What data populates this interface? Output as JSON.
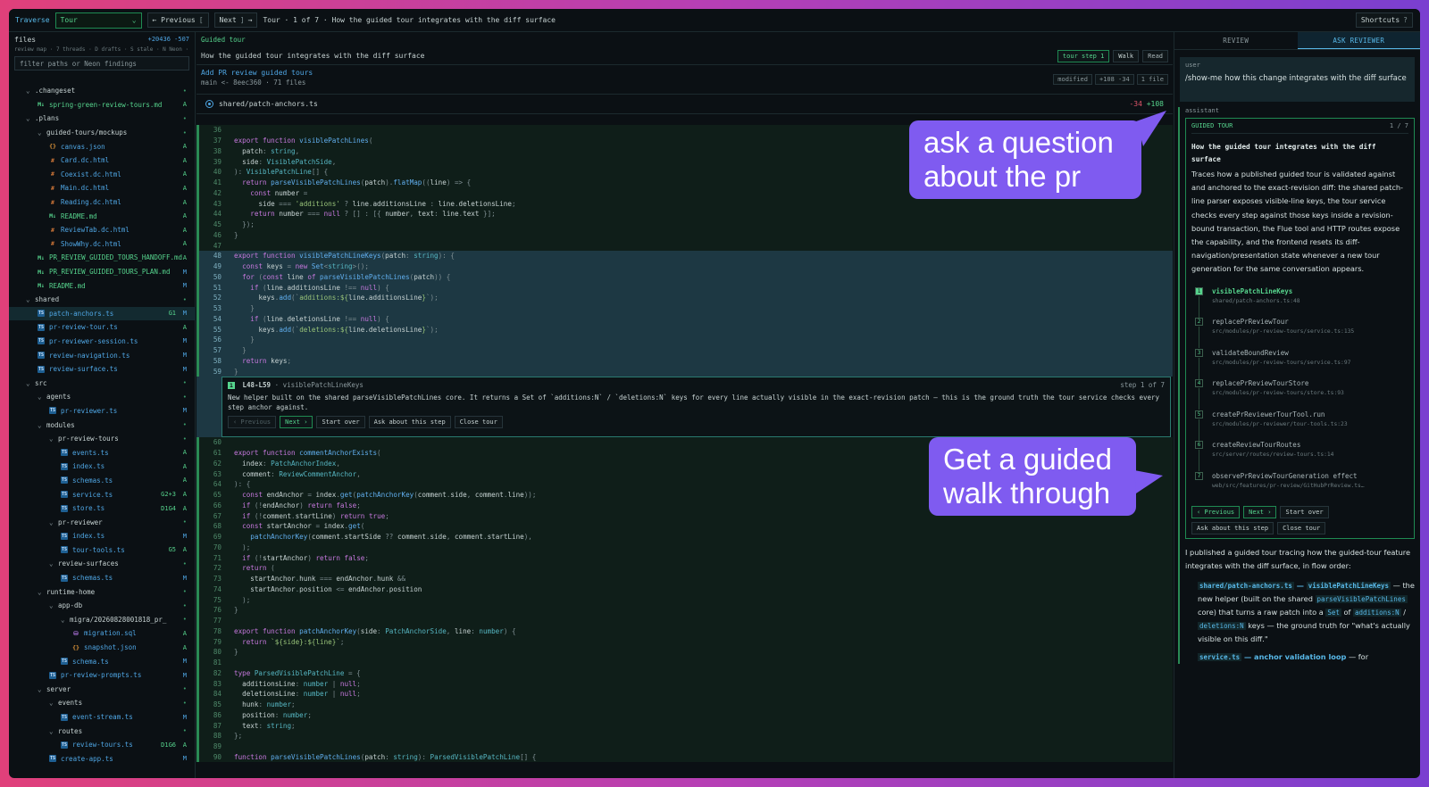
{
  "topbar": {
    "brand": "Traverse",
    "mode_select": "Tour",
    "prev_label": "← Previous",
    "prev_key": "[",
    "next_label": "Next",
    "next_key": "]",
    "next_arrow": "→",
    "breadcrumb": "Tour · 1 of 7 · How the guided tour integrates with the diff surface",
    "shortcuts_label": "Shortcuts",
    "shortcuts_key": "?"
  },
  "sidebar": {
    "title": "files",
    "additions": "+20436",
    "deletions": "-507",
    "meta": "review map · 7 threads · D drafts · S stale · N Neon ·",
    "filter_placeholder": "filter paths or Neon findings",
    "tree": [
      {
        "indent": 1,
        "kind": "dir",
        "name": ".changeset",
        "badge": "•"
      },
      {
        "indent": 2,
        "kind": "md",
        "name": "spring-green-review-tours.md",
        "badge": "A"
      },
      {
        "indent": 1,
        "kind": "dir",
        "name": ".plans",
        "badge": "•"
      },
      {
        "indent": 2,
        "kind": "dir",
        "name": "guided-tours/mockups",
        "badge": "•"
      },
      {
        "indent": 3,
        "kind": "json",
        "name": "canvas.json",
        "badge": "A"
      },
      {
        "indent": 3,
        "kind": "html",
        "name": "Card.dc.html",
        "badge": "A"
      },
      {
        "indent": 3,
        "kind": "html",
        "name": "Coexist.dc.html",
        "badge": "A"
      },
      {
        "indent": 3,
        "kind": "html",
        "name": "Main.dc.html",
        "badge": "A"
      },
      {
        "indent": 3,
        "kind": "html",
        "name": "Reading.dc.html",
        "badge": "A"
      },
      {
        "indent": 3,
        "kind": "md",
        "name": "README.md",
        "badge": "A"
      },
      {
        "indent": 3,
        "kind": "html",
        "name": "ReviewTab.dc.html",
        "badge": "A"
      },
      {
        "indent": 3,
        "kind": "html",
        "name": "ShowWhy.dc.html",
        "badge": "A"
      },
      {
        "indent": 2,
        "kind": "md",
        "name": "PR_REVIEW_GUIDED_TOURS_HANDOFF.md",
        "badge": "A"
      },
      {
        "indent": 2,
        "kind": "md",
        "name": "PR_REVIEW_GUIDED_TOURS_PLAN.md",
        "badge": "M"
      },
      {
        "indent": 2,
        "kind": "md",
        "name": "README.md",
        "badge": "M"
      },
      {
        "indent": 1,
        "kind": "dir",
        "name": "shared",
        "badge": "•"
      },
      {
        "indent": 2,
        "kind": "ts",
        "name": "patch-anchors.ts",
        "badge": "M",
        "extra": "G1",
        "selected": true
      },
      {
        "indent": 2,
        "kind": "ts",
        "name": "pr-review-tour.ts",
        "badge": "A"
      },
      {
        "indent": 2,
        "kind": "ts",
        "name": "pr-reviewer-session.ts",
        "badge": "M"
      },
      {
        "indent": 2,
        "kind": "ts",
        "name": "review-navigation.ts",
        "badge": "M"
      },
      {
        "indent": 2,
        "kind": "ts",
        "name": "review-surface.ts",
        "badge": "M"
      },
      {
        "indent": 1,
        "kind": "dir",
        "name": "src",
        "badge": "•"
      },
      {
        "indent": 2,
        "kind": "dir",
        "name": "agents",
        "badge": "•"
      },
      {
        "indent": 3,
        "kind": "ts",
        "name": "pr-reviewer.ts",
        "badge": "M"
      },
      {
        "indent": 2,
        "kind": "dir",
        "name": "modules",
        "badge": "•"
      },
      {
        "indent": 3,
        "kind": "dir",
        "name": "pr-review-tours",
        "badge": "•"
      },
      {
        "indent": 4,
        "kind": "ts",
        "name": "events.ts",
        "badge": "A"
      },
      {
        "indent": 4,
        "kind": "ts",
        "name": "index.ts",
        "badge": "A"
      },
      {
        "indent": 4,
        "kind": "ts",
        "name": "schemas.ts",
        "badge": "A"
      },
      {
        "indent": 4,
        "kind": "ts",
        "name": "service.ts",
        "badge": "A",
        "extra": "G2+3"
      },
      {
        "indent": 4,
        "kind": "ts",
        "name": "store.ts",
        "badge": "A",
        "extra": "D1G4"
      },
      {
        "indent": 3,
        "kind": "dir",
        "name": "pr-reviewer",
        "badge": "•"
      },
      {
        "indent": 4,
        "kind": "ts",
        "name": "index.ts",
        "badge": "M"
      },
      {
        "indent": 4,
        "kind": "ts",
        "name": "tour-tools.ts",
        "badge": "A",
        "extra": "G5"
      },
      {
        "indent": 3,
        "kind": "dir",
        "name": "review-surfaces",
        "badge": "•"
      },
      {
        "indent": 4,
        "kind": "ts",
        "name": "schemas.ts",
        "badge": "M"
      },
      {
        "indent": 2,
        "kind": "dir",
        "name": "runtime-home",
        "badge": "•"
      },
      {
        "indent": 3,
        "kind": "dir",
        "name": "app-db",
        "badge": "•"
      },
      {
        "indent": 4,
        "kind": "dir",
        "name": "migra/20260828001818_pr_",
        "badge": "•"
      },
      {
        "indent": 5,
        "kind": "sql",
        "name": "migration.sql",
        "badge": "A"
      },
      {
        "indent": 5,
        "kind": "json",
        "name": "snapshot.json",
        "badge": "A"
      },
      {
        "indent": 4,
        "kind": "ts",
        "name": "schema.ts",
        "badge": "M"
      },
      {
        "indent": 3,
        "kind": "ts",
        "name": "pr-review-prompts.ts",
        "badge": "M"
      },
      {
        "indent": 2,
        "kind": "dir",
        "name": "server",
        "badge": "•"
      },
      {
        "indent": 3,
        "kind": "dir",
        "name": "events",
        "badge": "•"
      },
      {
        "indent": 4,
        "kind": "ts",
        "name": "event-stream.ts",
        "badge": "M"
      },
      {
        "indent": 3,
        "kind": "dir",
        "name": "routes",
        "badge": "•"
      },
      {
        "indent": 4,
        "kind": "ts",
        "name": "review-tours.ts",
        "badge": "A",
        "extra": "D1G6"
      },
      {
        "indent": 3,
        "kind": "ts",
        "name": "create-app.ts",
        "badge": "M"
      }
    ]
  },
  "main": {
    "section_label": "Guided tour",
    "tour_title": "How the guided tour integrates with the diff surface",
    "step_pill": "tour step 1",
    "walk_label": "Walk",
    "read_label": "Read",
    "pr_title": "Add PR review guided tours",
    "pr_sub": "main <- 8eec360 · 71 files",
    "pr_tags": [
      "modified",
      "+108 -34",
      "1 file"
    ],
    "file_path": "shared/patch-anchors.ts",
    "file_del": "-34",
    "file_add": "+108",
    "callout": {
      "step_badge": "1",
      "range": "L48-L59",
      "symbol": "· visiblePatchLineKeys",
      "step_of": "step 1 of 7",
      "body": "New helper built on the shared parseVisiblePatchLines core. It returns a Set of `additions:N` / `deletions:N` keys for every line actually visible in the exact-revision patch — this is the ground truth the tour service checks every step anchor against.",
      "prev": "‹ Previous",
      "next": "Next ›",
      "start_over": "Start over",
      "ask": "Ask about this step",
      "close": "Close tour"
    }
  },
  "bubbles": {
    "question": "ask a question about the pr",
    "walk": "Get a guided walk through"
  },
  "right": {
    "tabs": [
      "REVIEW",
      "ASK REVIEWER"
    ],
    "user_role": "user",
    "user_text": "/show-me how this change integrates with the diff surface",
    "assistant_role": "assistant",
    "card_label": "GUIDED TOUR",
    "card_count": "1 / 7",
    "card_title": "How the guided tour integrates with the diff surface",
    "card_desc": "Traces how a published guided tour is validated against and anchored to the exact-revision diff: the shared patch-line parser exposes visible-line keys, the tour service checks every step against those keys inside a revision-bound transaction, the Flue tool and HTTP routes expose the capability, and the frontend resets its diff-navigation/presentation state whenever a new tour generation for the same conversation appears.",
    "steps": [
      {
        "n": "1",
        "name": "visiblePatchLineKeys",
        "path": "shared/patch-anchors.ts:48",
        "active": true
      },
      {
        "n": "2",
        "name": "replacePrReviewTour",
        "path": "src/modules/pr-review-tours/service.ts:135"
      },
      {
        "n": "3",
        "name": "validateBoundReview",
        "path": "src/modules/pr-review-tours/service.ts:97"
      },
      {
        "n": "4",
        "name": "replacePrReviewTourStore",
        "path": "src/modules/pr-review-tours/store.ts:93"
      },
      {
        "n": "5",
        "name": "createPrReviewerTourTool.run",
        "path": "src/modules/pr-reviewer/tour-tools.ts:23"
      },
      {
        "n": "6",
        "name": "createReviewTourRoutes",
        "path": "src/server/routes/review-tours.ts:14"
      },
      {
        "n": "7",
        "name": "observePrReviewTourGeneration effect",
        "path": "web/src/features/pr-review/GitHubPrReview.ts…"
      }
    ],
    "btn_prev": "‹ Previous",
    "btn_next": "Next ›",
    "btn_start": "Start over",
    "btn_ask": "Ask about this step",
    "btn_close": "Close tour",
    "after_intro": "I published a guided tour tracing how the guided-tour feature integrates with the diff surface, in flow order:",
    "b1_code1": "shared/patch-anchors.ts",
    "b1_dash": " — ",
    "b1_code2": "visiblePatchLineKeys",
    "b1_t1": " — the new helper (built on the shared ",
    "b1_code3": "parseVisiblePatchLines",
    "b1_t2": " core) that turns a raw patch into a ",
    "b1_code4": "Set",
    "b1_t3": " of ",
    "b1_code5": "additions:N",
    "b1_t4": " / ",
    "b1_code6": "deletions:N",
    "b1_t5": " keys — the ground truth for \"what's actually visible on this diff.\"",
    "b2_code": "service.ts",
    "b2_rest": " — anchor validation loop",
    "b2_t": " — for"
  },
  "colors": {
    "accent_green": "#56d48d",
    "accent_blue": "#58b8e8",
    "bubble": "#7f5bf0",
    "bg": "#0b1014"
  }
}
